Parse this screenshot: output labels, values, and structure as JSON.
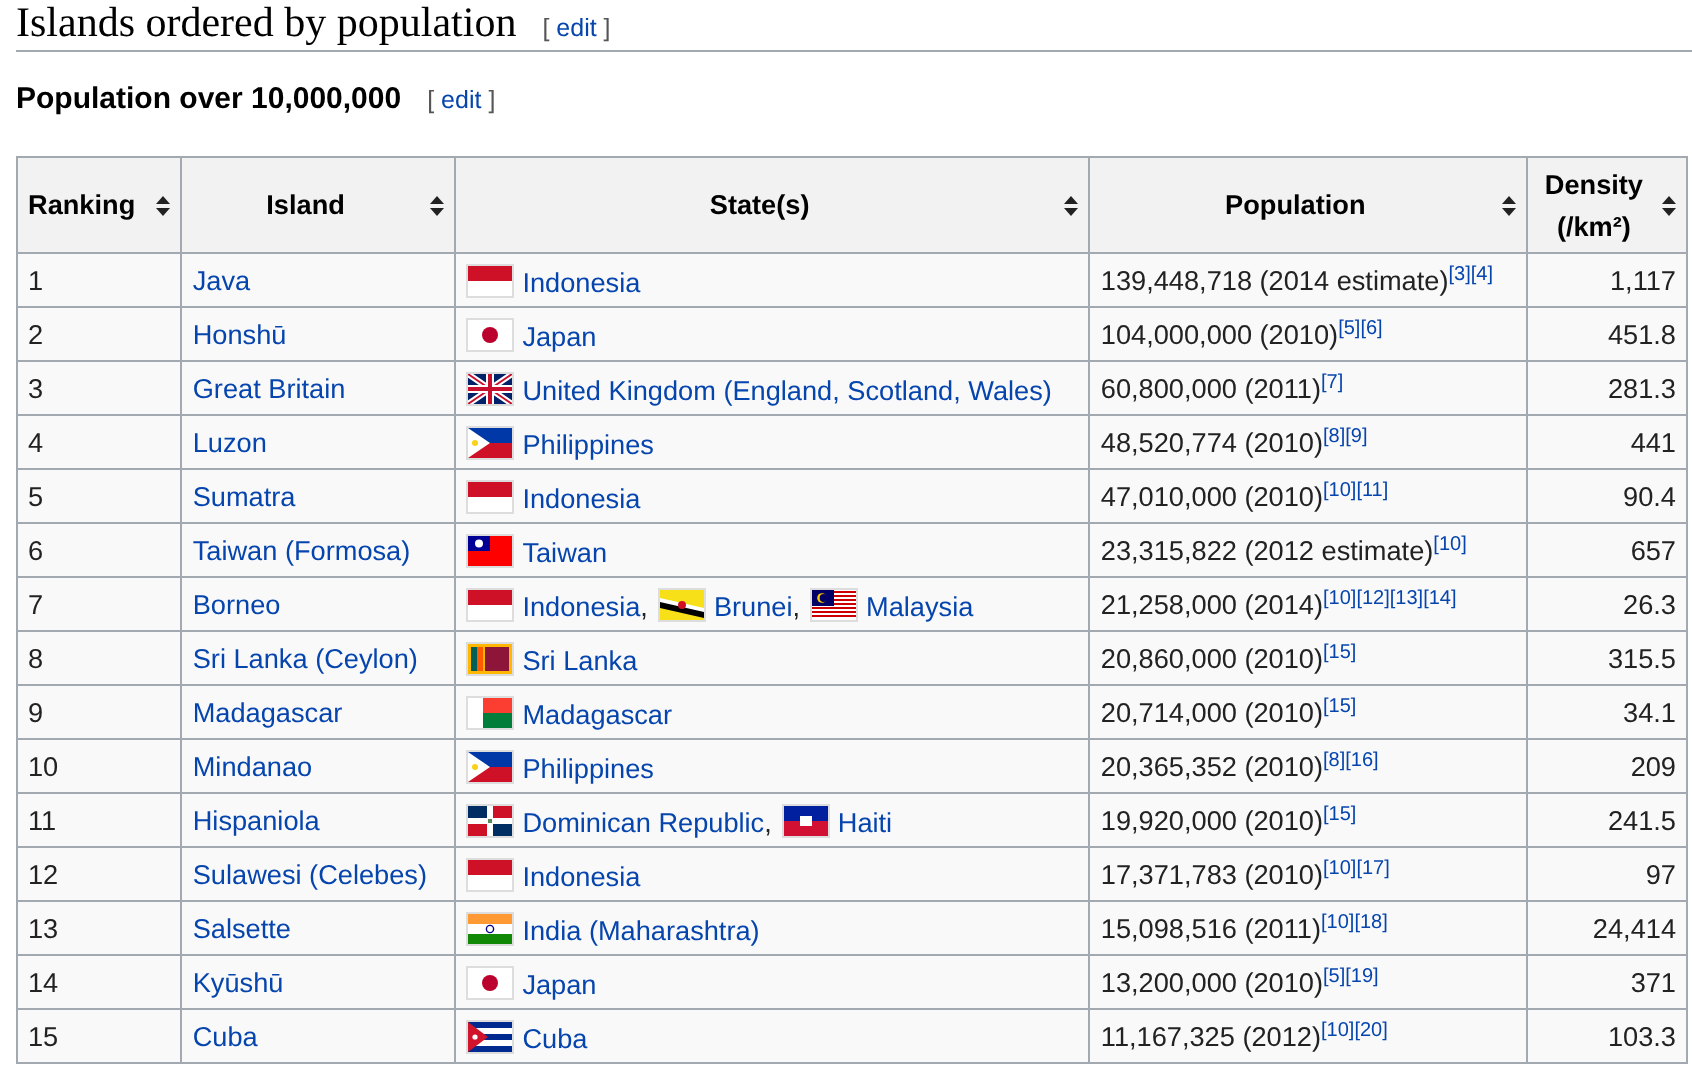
{
  "section": {
    "title": "Islands ordered by population",
    "edit": {
      "open": "[",
      "label": "edit",
      "close": "]"
    }
  },
  "subsection": {
    "title": "Population over 10,000,000",
    "edit": {
      "open": "[",
      "label": "edit",
      "close": "]"
    }
  },
  "table": {
    "columns": [
      {
        "label": "Ranking"
      },
      {
        "label": "Island"
      },
      {
        "label": "State(s)"
      },
      {
        "label": "Population"
      },
      {
        "label": "Density (/km²)"
      }
    ],
    "rows": [
      {
        "rank": "1",
        "island": "Java",
        "states": [
          {
            "name": "Indonesia",
            "kind": "indonesia"
          }
        ],
        "population": "139,448,718 (2014 estimate)",
        "refs": [
          "[3]",
          "[4]"
        ],
        "density": "1,117"
      },
      {
        "rank": "2",
        "island": "Honshū",
        "states": [
          {
            "name": "Japan",
            "kind": "japan"
          }
        ],
        "population": "104,000,000 (2010)",
        "refs": [
          "[5]",
          "[6]"
        ],
        "density": "451.8"
      },
      {
        "rank": "3",
        "island": "Great Britain",
        "states": [
          {
            "name": "United Kingdom (England, Scotland, Wales)",
            "kind": "uk"
          }
        ],
        "population": "60,800,000 (2011)",
        "refs": [
          "[7]"
        ],
        "density": "281.3"
      },
      {
        "rank": "4",
        "island": "Luzon",
        "states": [
          {
            "name": "Philippines",
            "kind": "philippines"
          }
        ],
        "population": "48,520,774 (2010)",
        "refs": [
          "[8]",
          "[9]"
        ],
        "density": "441"
      },
      {
        "rank": "5",
        "island": "Sumatra",
        "states": [
          {
            "name": "Indonesia",
            "kind": "indonesia"
          }
        ],
        "population": "47,010,000 (2010)",
        "refs": [
          "[10]",
          "[11]"
        ],
        "density": "90.4"
      },
      {
        "rank": "6",
        "island": "Taiwan (Formosa)",
        "states": [
          {
            "name": "Taiwan",
            "kind": "taiwan"
          }
        ],
        "population": "23,315,822 (2012 estimate)",
        "refs": [
          "[10]"
        ],
        "density": "657"
      },
      {
        "rank": "7",
        "island": "Borneo",
        "states": [
          {
            "name": "Indonesia",
            "kind": "indonesia",
            "separator": ","
          },
          {
            "name": "Brunei",
            "kind": "brunei",
            "separator": ","
          },
          {
            "name": "Malaysia",
            "kind": "malaysia"
          }
        ],
        "population": "21,258,000 (2014)",
        "refs": [
          "[10]",
          "[12]",
          "[13]",
          "[14]"
        ],
        "density": "26.3"
      },
      {
        "rank": "8",
        "island": "Sri Lanka (Ceylon)",
        "states": [
          {
            "name": "Sri Lanka",
            "kind": "sri-lanka"
          }
        ],
        "population": "20,860,000 (2010)",
        "refs": [
          "[15]"
        ],
        "density": "315.5"
      },
      {
        "rank": "9",
        "island": "Madagascar",
        "states": [
          {
            "name": "Madagascar",
            "kind": "madagascar"
          }
        ],
        "population": "20,714,000 (2010)",
        "refs": [
          "[15]"
        ],
        "density": "34.1"
      },
      {
        "rank": "10",
        "island": "Mindanao",
        "states": [
          {
            "name": "Philippines",
            "kind": "philippines"
          }
        ],
        "population": "20,365,352 (2010)",
        "refs": [
          "[8]",
          "[16]"
        ],
        "density": "209"
      },
      {
        "rank": "11",
        "island": "Hispaniola",
        "states": [
          {
            "name": "Dominican Republic",
            "kind": "dominican-republic",
            "separator": ","
          },
          {
            "name": "Haiti",
            "kind": "haiti"
          }
        ],
        "population": "19,920,000 (2010)",
        "refs": [
          "[15]"
        ],
        "density": "241.5"
      },
      {
        "rank": "12",
        "island": "Sulawesi (Celebes)",
        "states": [
          {
            "name": "Indonesia",
            "kind": "indonesia"
          }
        ],
        "population": "17,371,783 (2010)",
        "refs": [
          "[10]",
          "[17]"
        ],
        "density": "97"
      },
      {
        "rank": "13",
        "island": "Salsette",
        "states": [
          {
            "name": "India (Maharashtra)",
            "kind": "india"
          }
        ],
        "population": "15,098,516 (2011)",
        "refs": [
          "[10]",
          "[18]"
        ],
        "density": "24,414"
      },
      {
        "rank": "14",
        "island": "Kyūshū",
        "states": [
          {
            "name": "Japan",
            "kind": "japan"
          }
        ],
        "population": "13,200,000 (2010)",
        "refs": [
          "[5]",
          "[19]"
        ],
        "density": "371"
      },
      {
        "rank": "15",
        "island": "Cuba",
        "states": [
          {
            "name": "Cuba",
            "kind": "cuba"
          }
        ],
        "population": "11,167,325 (2012)",
        "refs": [
          "[10]",
          "[20]"
        ],
        "density": "103.3"
      }
    ]
  }
}
